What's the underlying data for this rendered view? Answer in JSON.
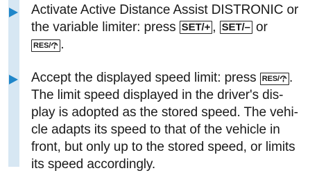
{
  "steps": [
    {
      "line1": "Activate Active Distance Assist DISTRONIC or",
      "line2_pre": "the variable limiter: press ",
      "key_set_plus": "SET/+",
      "sep_comma": ", ",
      "key_set_minus": "SET/–",
      "line2_post": " or",
      "key_res": "RES/",
      "line3_post": "."
    },
    {
      "line1_pre": "Accept the displayed speed limit: press ",
      "key_res": "RES/",
      "line1_post": ".",
      "lines": [
        "The limit speed displayed in the driver's dis-",
        "play is adopted as the stored speed. The vehi-",
        "cle adapts its speed to that of the vehicle in",
        "front, but only up to the stored speed, or limits",
        "its speed accordingly."
      ]
    }
  ],
  "icons": {
    "step_marker": "triangle-right-icon",
    "res_symbol": "speedometer-resume-icon"
  },
  "colors": {
    "accent": "#1f86c9",
    "bar": "#d7e7f3"
  }
}
